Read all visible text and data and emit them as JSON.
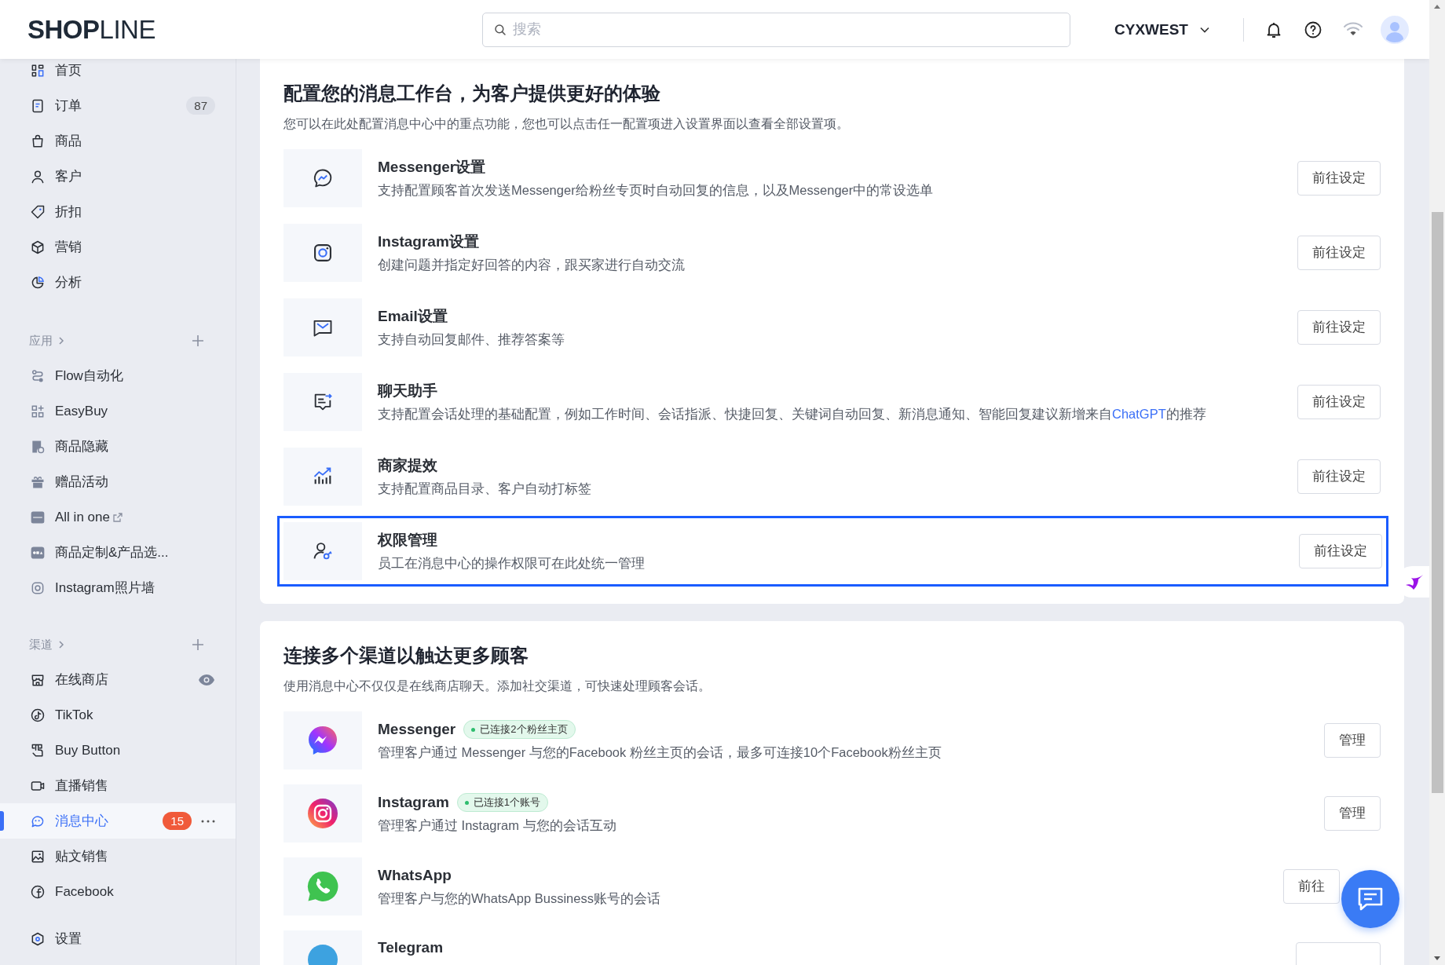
{
  "header": {
    "logo": "**SHOP**LINE",
    "search": {
      "placeholder": "搜索"
    },
    "account": "CYXWEST"
  },
  "sidebar": {
    "groups": [
      {
        "items": [
          {
            "label": "首页",
            "selected": false
          },
          {
            "label": "订单",
            "selected": false,
            "badge": {
              "text": "87",
              "color": "#dde0e8"
            }
          },
          {
            "label": "商品",
            "selected": false
          },
          {
            "label": "客户",
            "selected": false
          },
          {
            "label": "折扣",
            "selected": false
          },
          {
            "label": "营销",
            "selected": false
          },
          {
            "label": "分析",
            "selected": false
          }
        ]
      },
      {
        "heading": "应用",
        "items": [
          {
            "label": "Flow自动化",
            "selected": false
          },
          {
            "label": "EasyBuy",
            "selected": false
          },
          {
            "label": "商品隐藏",
            "selected": false
          },
          {
            "label": "赠品活动",
            "selected": false
          },
          {
            "label": "All in one",
            "selected": false
          },
          {
            "label": "商品定制&产品选...",
            "selected": false
          },
          {
            "label": "Instagram照片墙",
            "selected": false
          }
        ]
      },
      {
        "heading": "渠道",
        "items": [
          {
            "label": "在线商店",
            "selected": false
          },
          {
            "label": "TikTok",
            "selected": false
          },
          {
            "label": "Buy Button",
            "selected": false
          },
          {
            "label": "直播销售",
            "selected": false
          },
          {
            "label": "消息中心",
            "selected": true,
            "badge": {
              "text": "15",
              "color": "#f05a3a"
            }
          },
          {
            "label": "贴文销售",
            "selected": false
          },
          {
            "label": "Facebook",
            "selected": false
          }
        ]
      },
      {
        "items": [
          {
            "label": "设置",
            "selected": false
          }
        ]
      }
    ]
  },
  "config": {
    "title": "配置您的消息工作台，为客户提供更好的体验",
    "subtitle": "您可以在此处配置消息中心中的重点功能，您也可以点击任一配置项进入设置界面以查看全部设置项。",
    "rows": [
      {
        "title": "Messenger设置",
        "desc": "支持配置顾客首次发送Messenger给粉丝专页时自动回复的信息，以及Messenger中的常设选单",
        "button": "前往设定",
        "highlighted": false
      },
      {
        "title": "Instagram设置",
        "desc": "创建问题并指定好回答的内容，跟买家进行自动交流",
        "button": "前往设定",
        "highlighted": false
      },
      {
        "title": "Email设置",
        "desc": "支持自动回复邮件、推荐答案等",
        "button": "前往设定",
        "highlighted": false
      },
      {
        "title": "聊天助手",
        "desc": "支持配置会话处理的基础配置，例如工作时间、会话指派、快捷回复、关键词自动回复、新消息通知、智能回复建议新增来自",
        "link": "ChatGPT",
        "desc_end": "的推荐",
        "button": "前往设定",
        "highlighted": false
      },
      {
        "title": "商家提效",
        "desc": "支持配置商品目录、客户自动打标签",
        "button": "前往设定",
        "highlighted": false
      },
      {
        "title": "权限管理",
        "desc": "员工在消息中心的操作权限可在此处统一管理",
        "button": "前往设定",
        "highlighted": true
      }
    ]
  },
  "channels": {
    "title": "连接多个渠道以触达更多顾客",
    "subtitle": "使用消息中心不仅仅是在线商店聊天。添加社交渠道，可快速处理顾客会话。",
    "rows": [
      {
        "title": "Messenger",
        "tag": "已连接2个粉丝主页",
        "desc": "管理客户通过 Messenger 与您的Facebook 粉丝主页的会话，最多可连接10个Facebook粉丝主页",
        "button": "管理"
      },
      {
        "title": "Instagram",
        "tag": "已连接1个账号",
        "desc": "管理客户通过 Instagram 与您的会话互动",
        "button": "管理"
      },
      {
        "title": "WhatsApp",
        "desc": "管理客户与您的WhatsApp Bussiness账号的会话",
        "button": "前往"
      },
      {
        "title": "Telegram"
      }
    ]
  }
}
